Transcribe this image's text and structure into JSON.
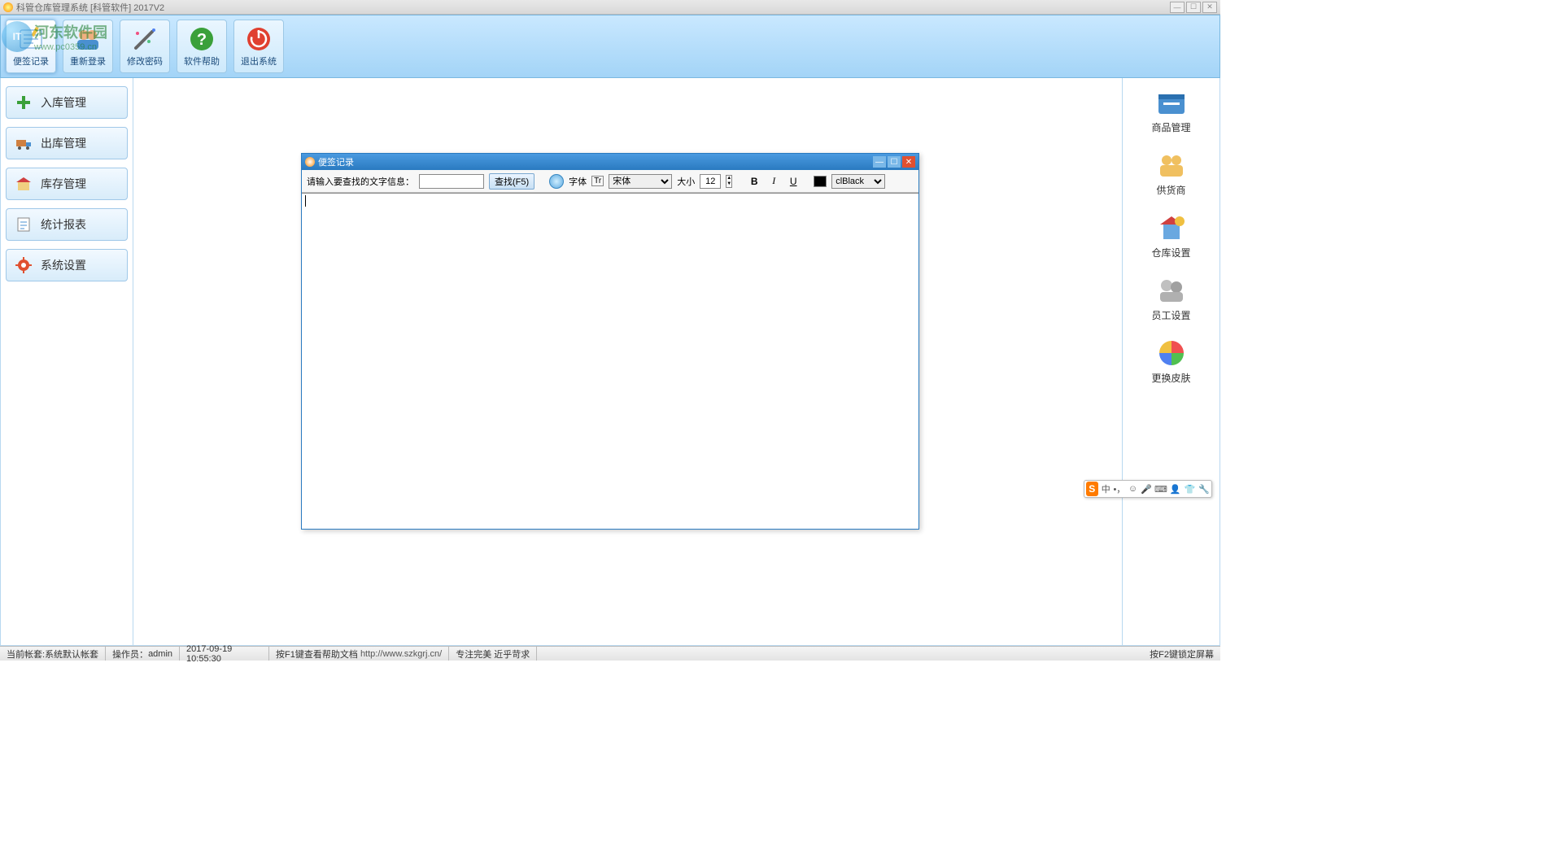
{
  "app": {
    "title": "科管仓库管理系统 [科管软件] 2017V2"
  },
  "toolbar": {
    "note": "便签记录",
    "relogin": "重新登录",
    "password": "修改密码",
    "help": "软件帮助",
    "exit": "退出系统"
  },
  "nav": {
    "in": "入库管理",
    "out": "出库管理",
    "stock": "库存管理",
    "report": "统计报表",
    "settings": "系统设置"
  },
  "right": {
    "product": "商品管理",
    "supplier": "供货商",
    "warehouse": "仓库设置",
    "staff": "员工设置",
    "skin": "更换皮肤"
  },
  "inner": {
    "title": "便签记录",
    "search_label": "请输入要查找的文字信息：",
    "search_value": "",
    "search_btn": "查找(F5)",
    "font_label": "字体",
    "font_value": "宋体",
    "size_label": "大小",
    "size_value": "12",
    "color_value": "clBlack"
  },
  "status": {
    "account_label": "当前帐套:",
    "account_value": "系统默认帐套",
    "operator_label": "操作员：",
    "operator_value": "admin",
    "datetime": "2017-09-19 10:55:30",
    "help_hint": "按F1键查看帮助文档",
    "url": "http://www.szkgrj.cn/",
    "slogan": "专注完美 近乎苛求",
    "lock_hint": "按F2键锁定屏幕"
  },
  "ime": {
    "lang": "中",
    "logo": "S"
  },
  "watermark": {
    "cn": "河东软件园",
    "url": "www.pc0359.cn"
  }
}
